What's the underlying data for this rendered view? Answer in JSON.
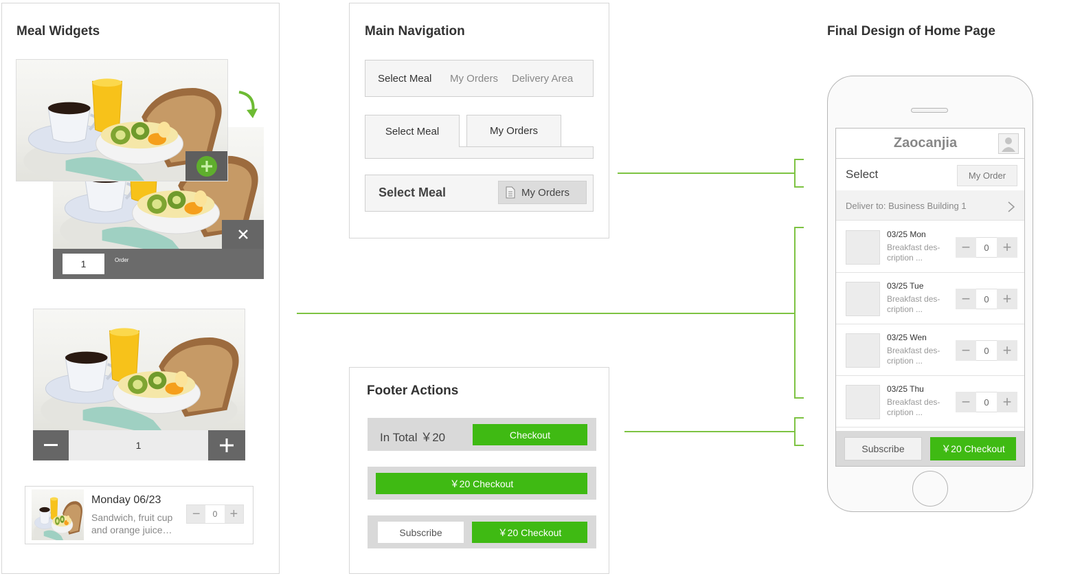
{
  "meal_widgets": {
    "title": "Meal Widgets",
    "card_a": {
      "qty": "1",
      "order_label": "Order"
    },
    "card_b": {
      "qty": "1"
    },
    "list_item": {
      "date": "Monday 06/23",
      "desc1": "Sandwich, fruit cup",
      "desc2": "and orange juice…",
      "qty": "0"
    }
  },
  "main_navigation": {
    "title": "Main Navigation",
    "style1": [
      "Select Meal",
      "My Orders",
      "Delivery Area"
    ],
    "style2": [
      "Select Meal",
      "My Orders"
    ],
    "style3": {
      "title": "Select Meal",
      "button": "My Orders"
    }
  },
  "footer_actions": {
    "title": "Footer Actions",
    "style1": {
      "total": "In Total ￥20",
      "checkout": "Checkout"
    },
    "style2": {
      "checkout": "￥20  Checkout"
    },
    "style3": {
      "subscribe": "Subscribe",
      "checkout": "￥20  Checkout"
    }
  },
  "final_design": {
    "title": "Final Design of Home Page",
    "app_name": "Zaocanjia",
    "select_label": "Select",
    "my_order_button": "My Order",
    "deliver_to": "Deliver to: Business Building 1",
    "rows": [
      {
        "date": "03/25 Mon",
        "desc1": "Breakfast des-",
        "desc2": "cription ...",
        "qty": "0"
      },
      {
        "date": "03/25 Tue",
        "desc1": "Breakfast des-",
        "desc2": "cription ...",
        "qty": "0"
      },
      {
        "date": "03/25 Wen",
        "desc1": "Breakfast des-",
        "desc2": "cription ...",
        "qty": "0"
      },
      {
        "date": "03/25 Thu",
        "desc1": "Breakfast des-",
        "desc2": "cription ...",
        "qty": "0"
      }
    ],
    "subscribe": "Subscribe",
    "checkout": "￥20  Checkout"
  },
  "colors": {
    "accent_green": "#3fba13",
    "connector_green": "#7dc342",
    "dark_gray": "#666666"
  },
  "icons": [
    "plus-circle-icon",
    "rotate-arrow-icon",
    "close-icon",
    "minus-icon",
    "plus-icon",
    "document-icon",
    "chevron-right-icon",
    "user-avatar-icon"
  ]
}
